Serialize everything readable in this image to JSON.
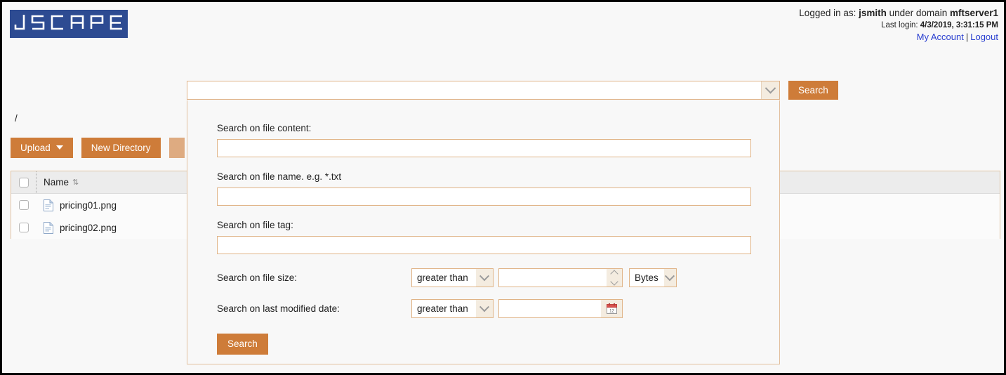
{
  "header": {
    "logo_text": "JSCAPE",
    "logged_in_prefix": "Logged in as: ",
    "username": "jsmith",
    "domain_prefix": " under domain ",
    "domain": "mftserver1",
    "last_login_label": "Last login: ",
    "last_login_value": "4/3/2019, 3:31:15 PM",
    "my_account_link": "My Account",
    "separator": "|",
    "logout_link": "Logout"
  },
  "breadcrumb": {
    "path": "/"
  },
  "toolbar": {
    "upload_label": "Upload",
    "new_directory_label": "New Directory"
  },
  "filetable": {
    "columns": [
      "Name"
    ],
    "sort_glyph": "⇅",
    "rows": [
      {
        "name": "pricing01.png"
      },
      {
        "name": "pricing02.png"
      }
    ]
  },
  "searchbar": {
    "combo_value": "",
    "search_button_label": "Search"
  },
  "search_panel": {
    "file_content_label": "Search on file content:",
    "file_content_value": "",
    "file_name_label": "Search on file name. e.g. *.txt",
    "file_name_value": "",
    "file_tag_label": "Search on file tag:",
    "file_tag_value": "",
    "file_size_label": "Search on file size:",
    "file_size_operator": "greater than",
    "file_size_value": "",
    "file_size_unit": "Bytes",
    "last_modified_label": "Search on last modified date:",
    "last_modified_operator": "greater than",
    "last_modified_value": "",
    "search_button_label": "Search"
  },
  "colors": {
    "accent_orange": "#ce7c39",
    "logo_blue": "#2d4b92",
    "link_blue": "#2a3fd0",
    "field_border": "#e0b487"
  }
}
